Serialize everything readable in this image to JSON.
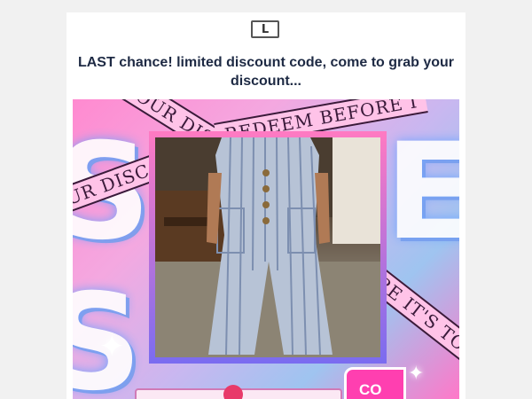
{
  "logo": {
    "letter": "L",
    "icon": "logo-mark"
  },
  "headline": "LAST chance! limited discount code, come to grab your discount...",
  "banner": {
    "ribbons": [
      "YOUR DISCO",
      "REDEEM BEFORE I",
      "UR DISCO",
      "RE IT'S TOO"
    ],
    "big_letters": [
      "S",
      "E",
      "S"
    ],
    "cta_label": "CO",
    "colors": {
      "pink": "#ff3fb0",
      "ribbon": "#ffc3e8",
      "blue": "#9fc4f0"
    }
  }
}
